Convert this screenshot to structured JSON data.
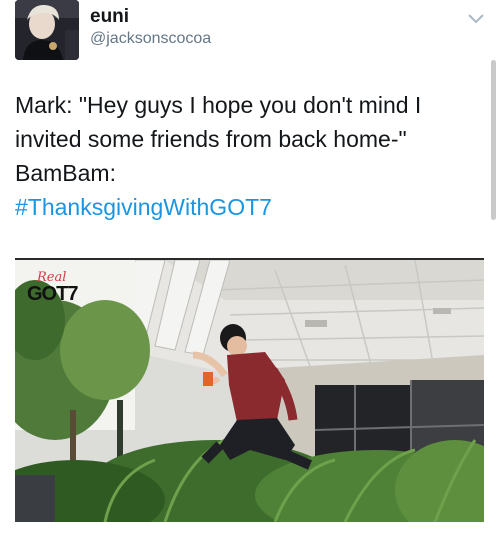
{
  "user": {
    "display_name": "euni",
    "handle": "@jacksonscocoa"
  },
  "tweet": {
    "line1": "Mark: \"Hey guys I hope you don't mind I",
    "line2": "invited some friends from back home-\"",
    "line3": "BamBam:",
    "hashtag": "#ThanksgivingWithGOT7"
  },
  "media": {
    "logo_real": "Real",
    "logo_got7": "GOT7"
  },
  "icons": {
    "menu": "chevron-down-icon"
  },
  "colors": {
    "hashtag": "#1b95e0",
    "handle": "#657786"
  }
}
